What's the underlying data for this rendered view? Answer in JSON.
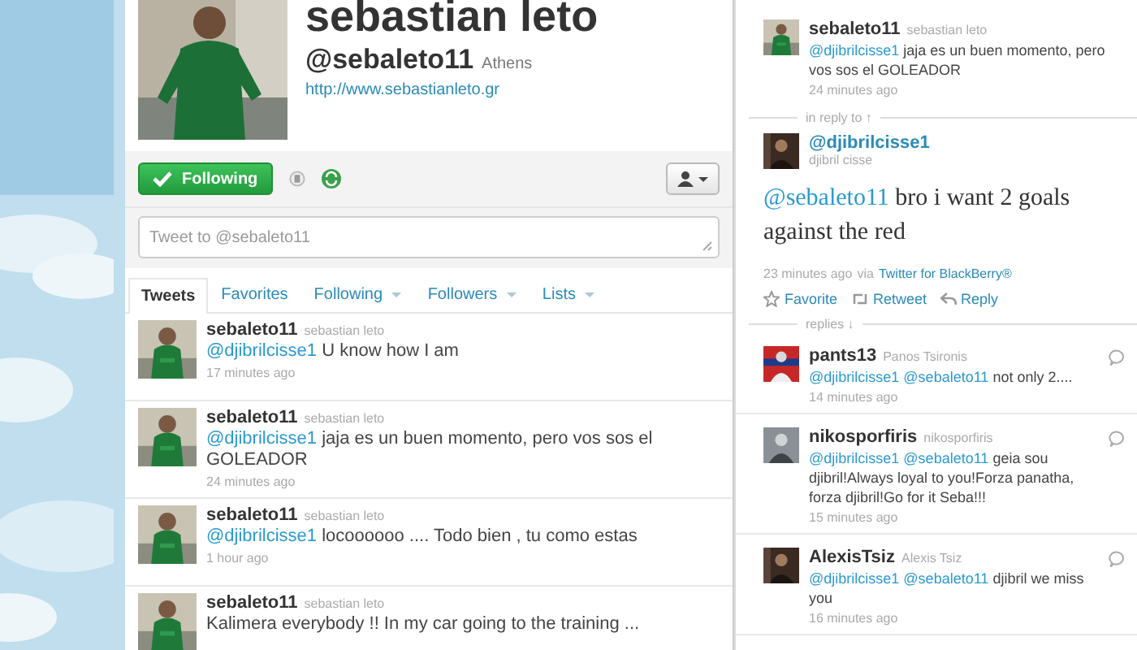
{
  "profile": {
    "name": "sebastian leto",
    "handle": "@sebaleto11",
    "location": "Athens",
    "url": "http://www.sebastianleto.gr"
  },
  "follow_button": {
    "label": "Following",
    "following": true
  },
  "tweet_box": {
    "placeholder": "Tweet to @sebaleto11"
  },
  "tabs": [
    {
      "label": "Tweets",
      "selected": true,
      "dropdown": false
    },
    {
      "label": "Favorites",
      "selected": false,
      "dropdown": false
    },
    {
      "label": "Following",
      "selected": false,
      "dropdown": true
    },
    {
      "label": "Followers",
      "selected": false,
      "dropdown": true
    },
    {
      "label": "Lists",
      "selected": false,
      "dropdown": true
    }
  ],
  "tweets": [
    {
      "username": "sebaleto11",
      "full_name": "sebastian leto",
      "mention": "@djibrilcisse1",
      "text": "U know how I am",
      "time": "17 minutes ago"
    },
    {
      "username": "sebaleto11",
      "full_name": "sebastian leto",
      "mention": "@djibrilcisse1",
      "text": "jaja es un buen momento, pero vos sos el GOLEADOR",
      "time": "24 minutes ago"
    },
    {
      "username": "sebaleto11",
      "full_name": "sebastian leto",
      "mention": "@djibrilcisse1",
      "text": "locoooooo .... Todo bien , tu como estas",
      "time": "1 hour ago"
    },
    {
      "username": "sebaleto11",
      "full_name": "sebastian leto",
      "text": "Kalimera everybody !! In my car going to the training ..."
    }
  ],
  "detail": {
    "parent": {
      "username": "sebaleto11",
      "full_name": "sebastian leto",
      "mention": "@djibrilcisse1",
      "text": "jaja es un buen momento, pero vos sos el GOLEADOR",
      "time": "24 minutes ago"
    },
    "in_reply_label": "in reply to ↑",
    "main": {
      "handle": "@djibrilcisse1",
      "name": "djibril cisse",
      "mention": "@sebaleto11",
      "text": "bro i want 2 goals against the red",
      "time": "23 minutes ago",
      "via": "via",
      "source": "Twitter for BlackBerry®"
    },
    "actions": [
      {
        "kind": "favorite",
        "label": "Favorite"
      },
      {
        "kind": "retweet",
        "label": "Retweet"
      },
      {
        "kind": "reply",
        "label": "Reply"
      }
    ],
    "replies_label": "replies ↓",
    "replies": [
      {
        "username": "pants13",
        "full_name": "Panos Tsironis",
        "mentions": [
          "@djibrilcisse1",
          "@sebaleto11"
        ],
        "text": "not only 2....",
        "time": "14 minutes ago"
      },
      {
        "username": "nikosporfiris",
        "full_name": "nikosporfiris",
        "mentions": [
          "@djibrilcisse1",
          "@sebaleto11"
        ],
        "text": "geia sou djibril!Always loyal to you!Forza panatha, forza djibril!Go for it Seba!!!",
        "time": "15 minutes ago"
      },
      {
        "username": "AlexisTsiz",
        "full_name": "Alexis Tsiz",
        "mentions": [
          "@djibrilcisse1",
          "@sebaleto11"
        ],
        "text": "djibril we miss you",
        "time": "16 minutes ago"
      }
    ]
  }
}
